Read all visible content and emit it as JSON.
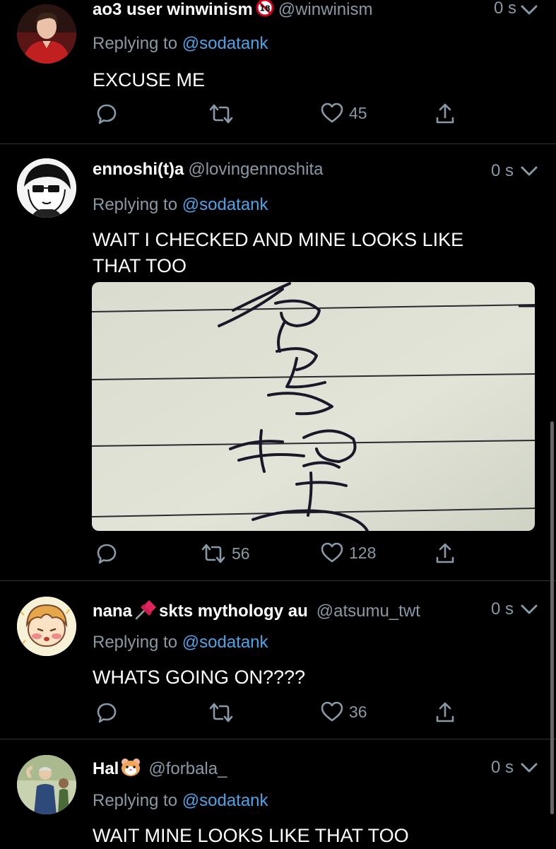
{
  "tweets": [
    {
      "name": "ao3 user winwinism",
      "handle": "@winwinism",
      "time": "0 s",
      "replying_prefix": "Replying to",
      "replying_to": "@sodatank",
      "text": "EXCUSE ME",
      "retweets": "",
      "likes": "45"
    },
    {
      "name": "ennoshi(t)a",
      "handle": "@lovingennoshita",
      "time": "0 s",
      "replying_prefix": "Replying to",
      "replying_to": "@sodatank",
      "text": "WAIT I CHECKED AND MINE LOOKS LIKE THAT TOO",
      "retweets": "56",
      "likes": "128"
    },
    {
      "name_part1": "nana",
      "name_part2": "skts mythology au",
      "handle": "@atsumu_twt",
      "time": "0 s",
      "replying_prefix": "Replying to",
      "replying_to": "@sodatank",
      "text": "WHATS GOING ON????",
      "retweets": "",
      "likes": "36"
    },
    {
      "name": "Hal",
      "handle": "@forbala_",
      "time": "0 s",
      "replying_prefix": "Replying to",
      "replying_to": "@sodatank",
      "text": "WAIT MINE LOOKS LIKE THAT TOO"
    }
  ],
  "icons": {
    "reply": "reply-icon",
    "retweet": "retweet-icon",
    "like": "heart-icon",
    "share": "share-icon",
    "caret": "chevron-down-icon"
  },
  "colors": {
    "background": "#000000",
    "text": "#ffffff",
    "secondary": "#8899a6",
    "link": "#4ea3e6",
    "divider": "#2f3336"
  }
}
